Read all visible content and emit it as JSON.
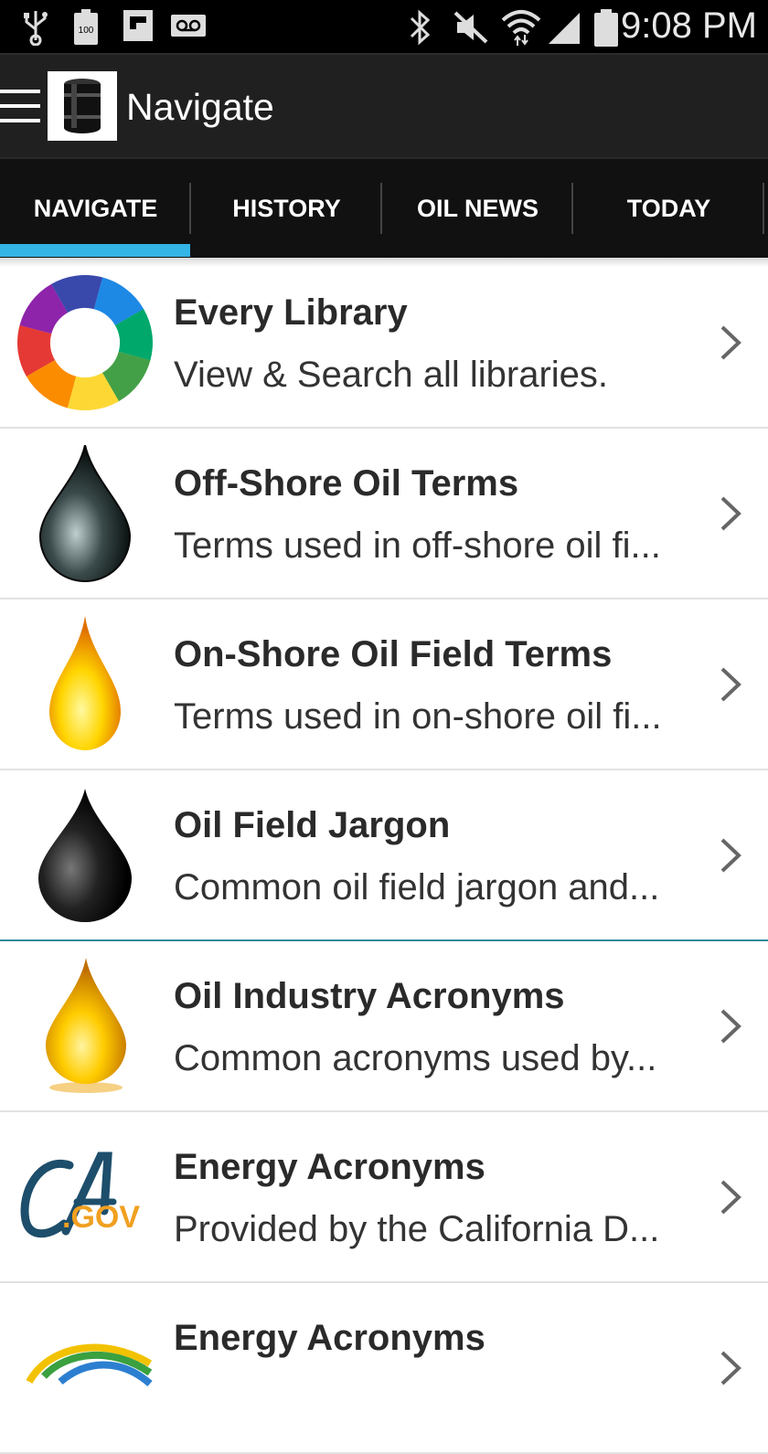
{
  "status_bar": {
    "time": "9:08 PM",
    "battery_text": "100",
    "icons": [
      "usb-icon",
      "battery-icon",
      "flipboard-icon",
      "voicemail-icon",
      "bluetooth-icon",
      "mute-icon",
      "wifi-icon",
      "signal-icon",
      "battery-level-icon"
    ]
  },
  "app_bar": {
    "title": "Navigate",
    "menu_icon": "hamburger-menu-icon",
    "logo_icon": "oil-barrel-icon"
  },
  "tabs": [
    {
      "label": "NAVIGATE",
      "selected": true
    },
    {
      "label": "HISTORY",
      "selected": false
    },
    {
      "label": "OIL NEWS",
      "selected": false
    },
    {
      "label": "TODAY",
      "selected": false
    }
  ],
  "colors": {
    "tab_indicator": "#33b5e5",
    "app_bar": "#202020",
    "tab_bar": "#111111"
  },
  "libraries": [
    {
      "title": "Every Library",
      "subtitle": "View & Search all libraries.",
      "icon": "puzzle-ring-icon"
    },
    {
      "title": "Off-Shore Oil Terms",
      "subtitle": "Terms used in off-shore oil fi...",
      "icon": "dark-oil-drop-icon"
    },
    {
      "title": "On-Shore Oil Field Terms",
      "subtitle": "Terms used in on-shore oil fi...",
      "icon": "yellow-oil-drop-icon"
    },
    {
      "title": "Oil Field Jargon",
      "subtitle": "Common oil field jargon and...",
      "icon": "black-oil-drop-icon"
    },
    {
      "title": "Oil Industry Acronyms",
      "subtitle": "Common acronyms used by...",
      "icon": "gold-oil-drop-icon"
    },
    {
      "title": "Energy Acronyms",
      "subtitle": "Provided by the California D...",
      "icon": "ca-gov-logo-icon"
    },
    {
      "title": "Energy Acronyms",
      "subtitle": "",
      "icon": "energy-swoosh-logo-icon"
    }
  ]
}
